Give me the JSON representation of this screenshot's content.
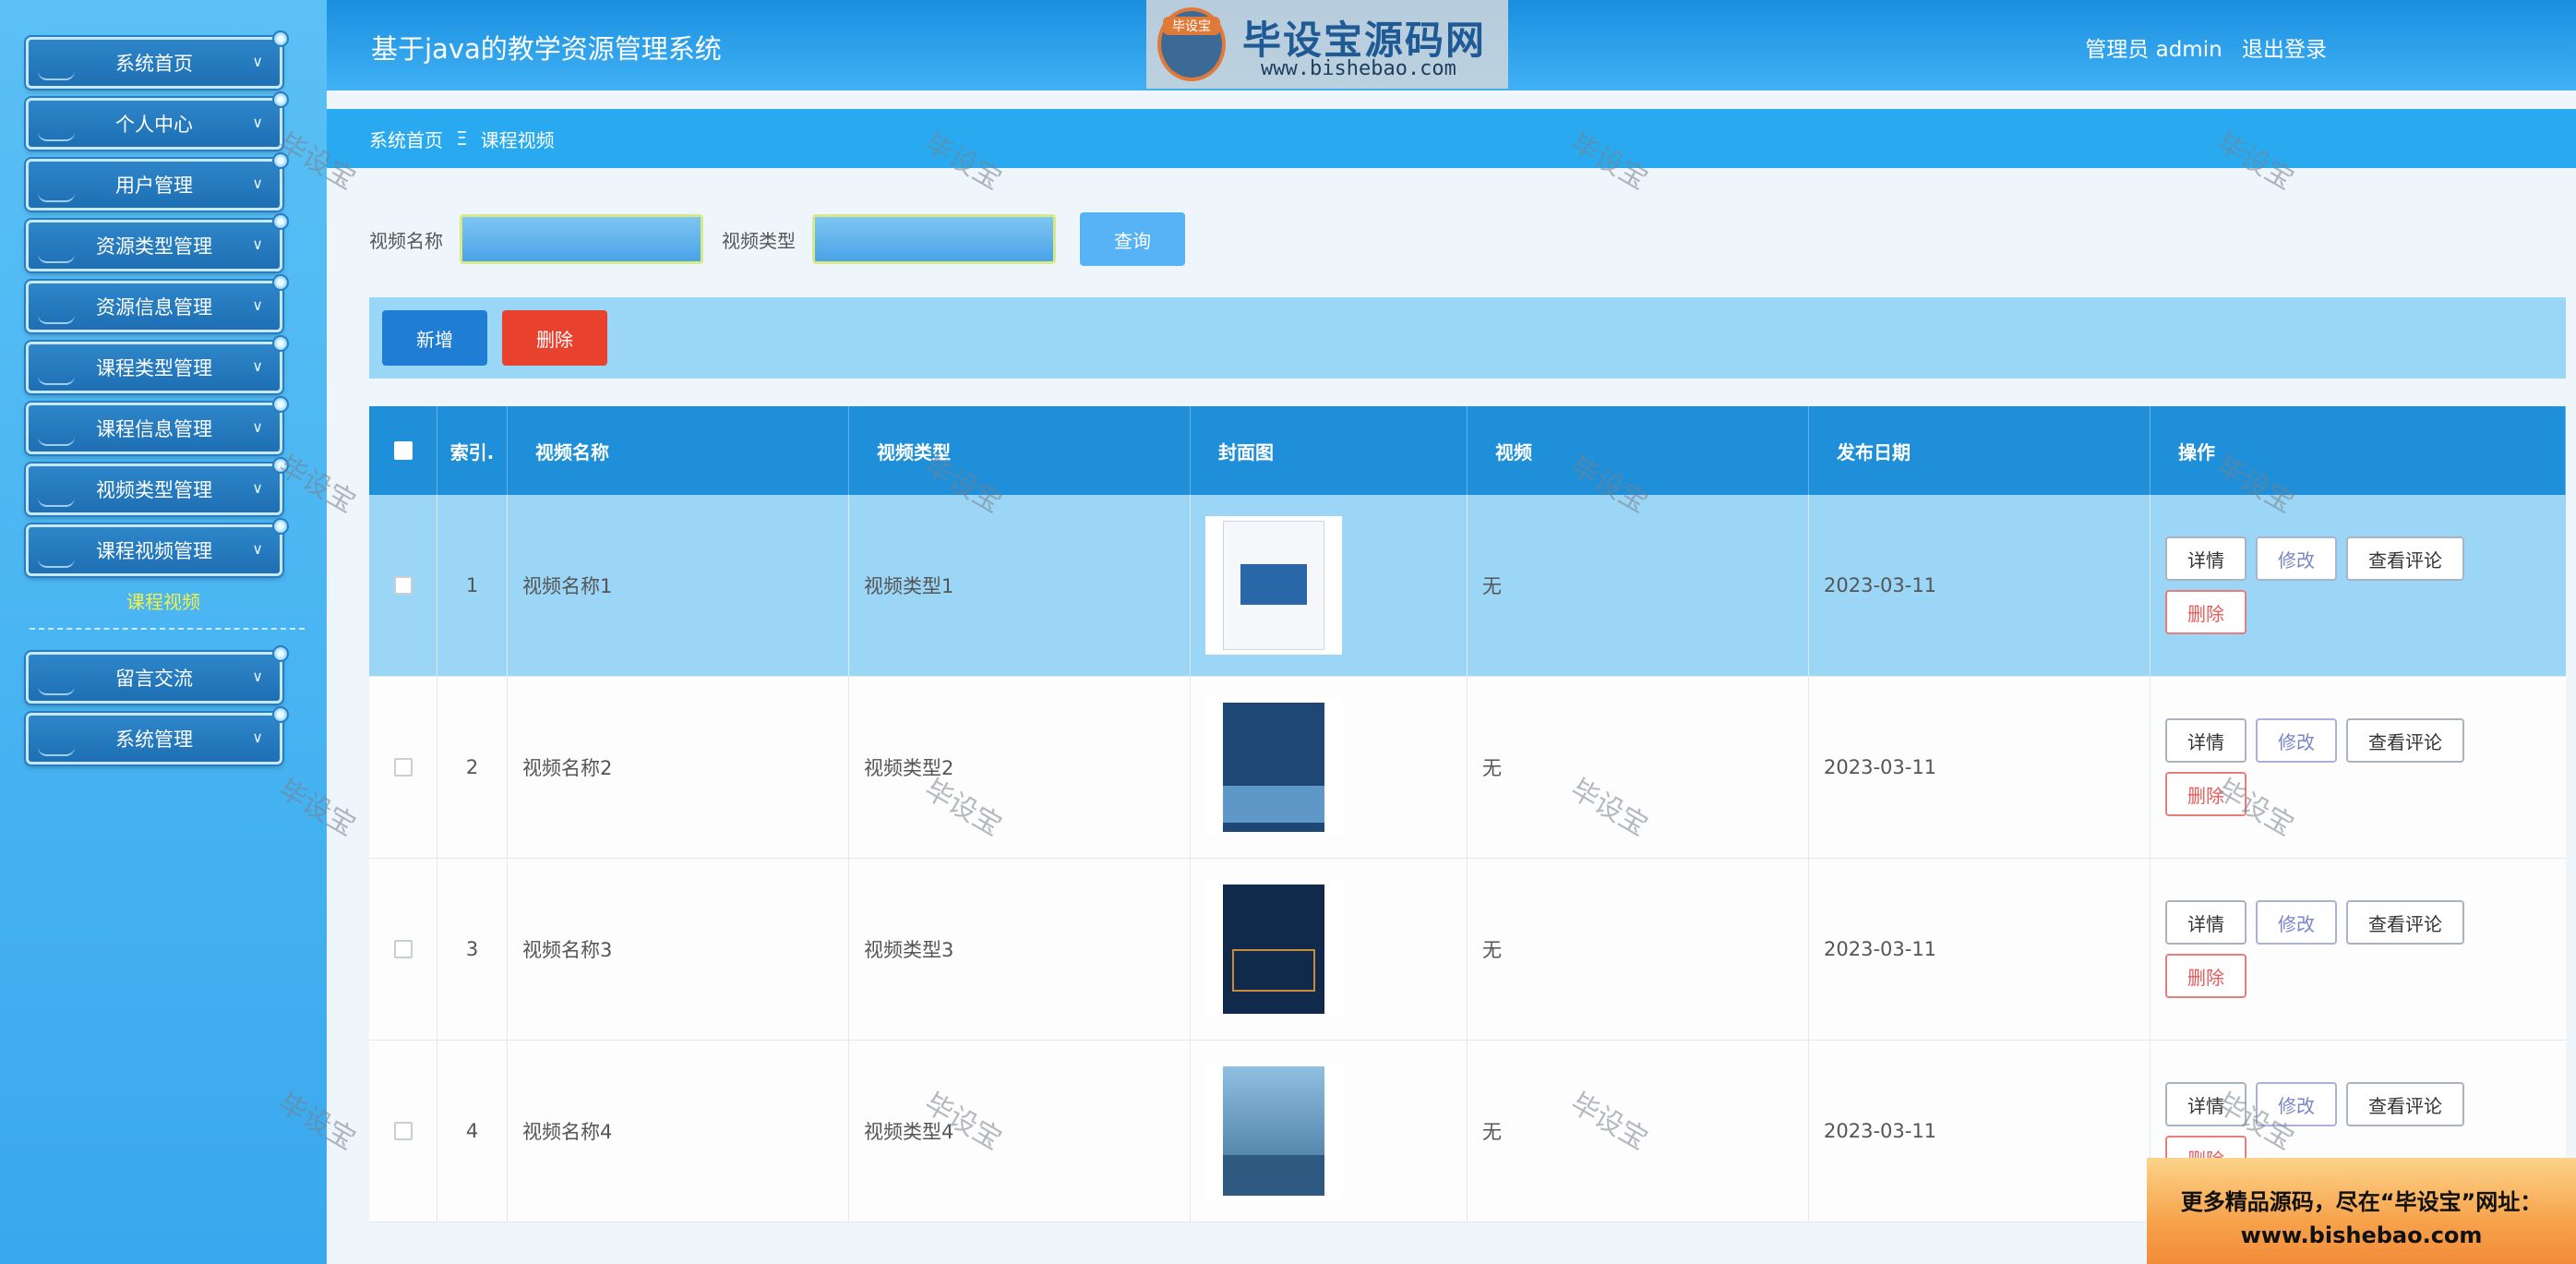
{
  "app": {
    "title": "基于java的教学资源管理系统",
    "user_label": "管理员 admin",
    "logout": "退出登录"
  },
  "logo": {
    "badge": "毕设宝",
    "main": "毕设宝源码网",
    "sub": "www.bishebao.com"
  },
  "sidebar": {
    "items": [
      {
        "label": "系统首页"
      },
      {
        "label": "个人中心"
      },
      {
        "label": "用户管理"
      },
      {
        "label": "资源类型管理"
      },
      {
        "label": "资源信息管理"
      },
      {
        "label": "课程类型管理"
      },
      {
        "label": "课程信息管理"
      },
      {
        "label": "视频类型管理"
      },
      {
        "label": "课程视频管理"
      },
      {
        "label": "留言交流"
      },
      {
        "label": "系统管理"
      }
    ],
    "active_subitem": "课程视频"
  },
  "breadcrumb": {
    "home": "系统首页",
    "separator": "Ξ",
    "current": "课程视频"
  },
  "search": {
    "name_label": "视频名称",
    "type_label": "视频类型",
    "name_value": "",
    "type_value": "",
    "query_button": "查询"
  },
  "actions": {
    "add": "新增",
    "delete": "删除"
  },
  "table": {
    "headers": {
      "index": "索引.",
      "name": "视频名称",
      "type": "视频类型",
      "cover": "封面图",
      "video": "视频",
      "date": "发布日期",
      "ops": "操作"
    },
    "rows": [
      {
        "index": "1",
        "name": "视频名称1",
        "type": "视频类型1",
        "video": "无",
        "date": "2023-03-11"
      },
      {
        "index": "2",
        "name": "视频名称2",
        "type": "视频类型2",
        "video": "无",
        "date": "2023-03-11"
      },
      {
        "index": "3",
        "name": "视频名称3",
        "type": "视频类型3",
        "video": "无",
        "date": "2023-03-11"
      },
      {
        "index": "4",
        "name": "视频名称4",
        "type": "视频类型4",
        "video": "无",
        "date": "2023-03-11"
      }
    ],
    "ops": {
      "detail": "详情",
      "edit": "修改",
      "comments": "查看评论",
      "delete": "删除"
    }
  },
  "watermark": "毕设宝",
  "ad": {
    "line1": "更多精品源码，尽在“毕设宝”网址：",
    "line2": "www.bishebao.com"
  },
  "colors": {
    "header": "#1a8fdf",
    "breadcrumb": "#29aaf0",
    "table_header": "#1e8fd8",
    "selected_row": "#9bd6f6",
    "add_button": "#1f7ed4",
    "delete_button": "#e8412e",
    "sub_active": "#f4ef4a"
  }
}
